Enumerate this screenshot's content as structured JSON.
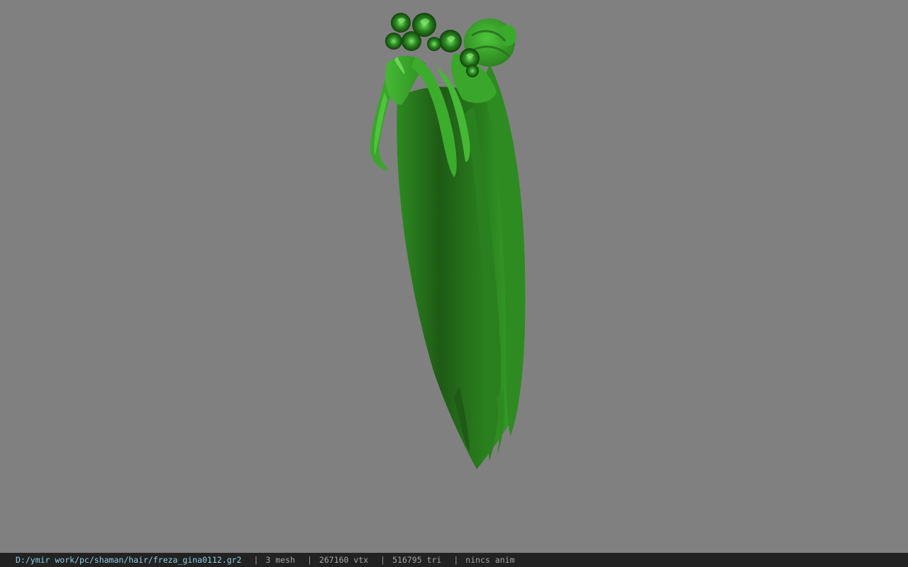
{
  "viewport": {
    "background": "#808080",
    "model": {
      "description_icon": "hair-mesh-model",
      "base_color": "#2f8f22",
      "highlight_color": "#4cc23a",
      "shadow_color": "#1d4f14"
    }
  },
  "statusbar": {
    "file_path": "D:/ymir work/pc/shaman/hair/freza_gina0112.gr2",
    "separator": "|",
    "mesh_count": "3 mesh",
    "vertex_count": "267160 vtx",
    "triangle_count": "516795 tri",
    "anim_status": "nincs anim",
    "path_color": "#8ecfe2",
    "text_color": "#a6a6a6",
    "background": "#222222"
  }
}
